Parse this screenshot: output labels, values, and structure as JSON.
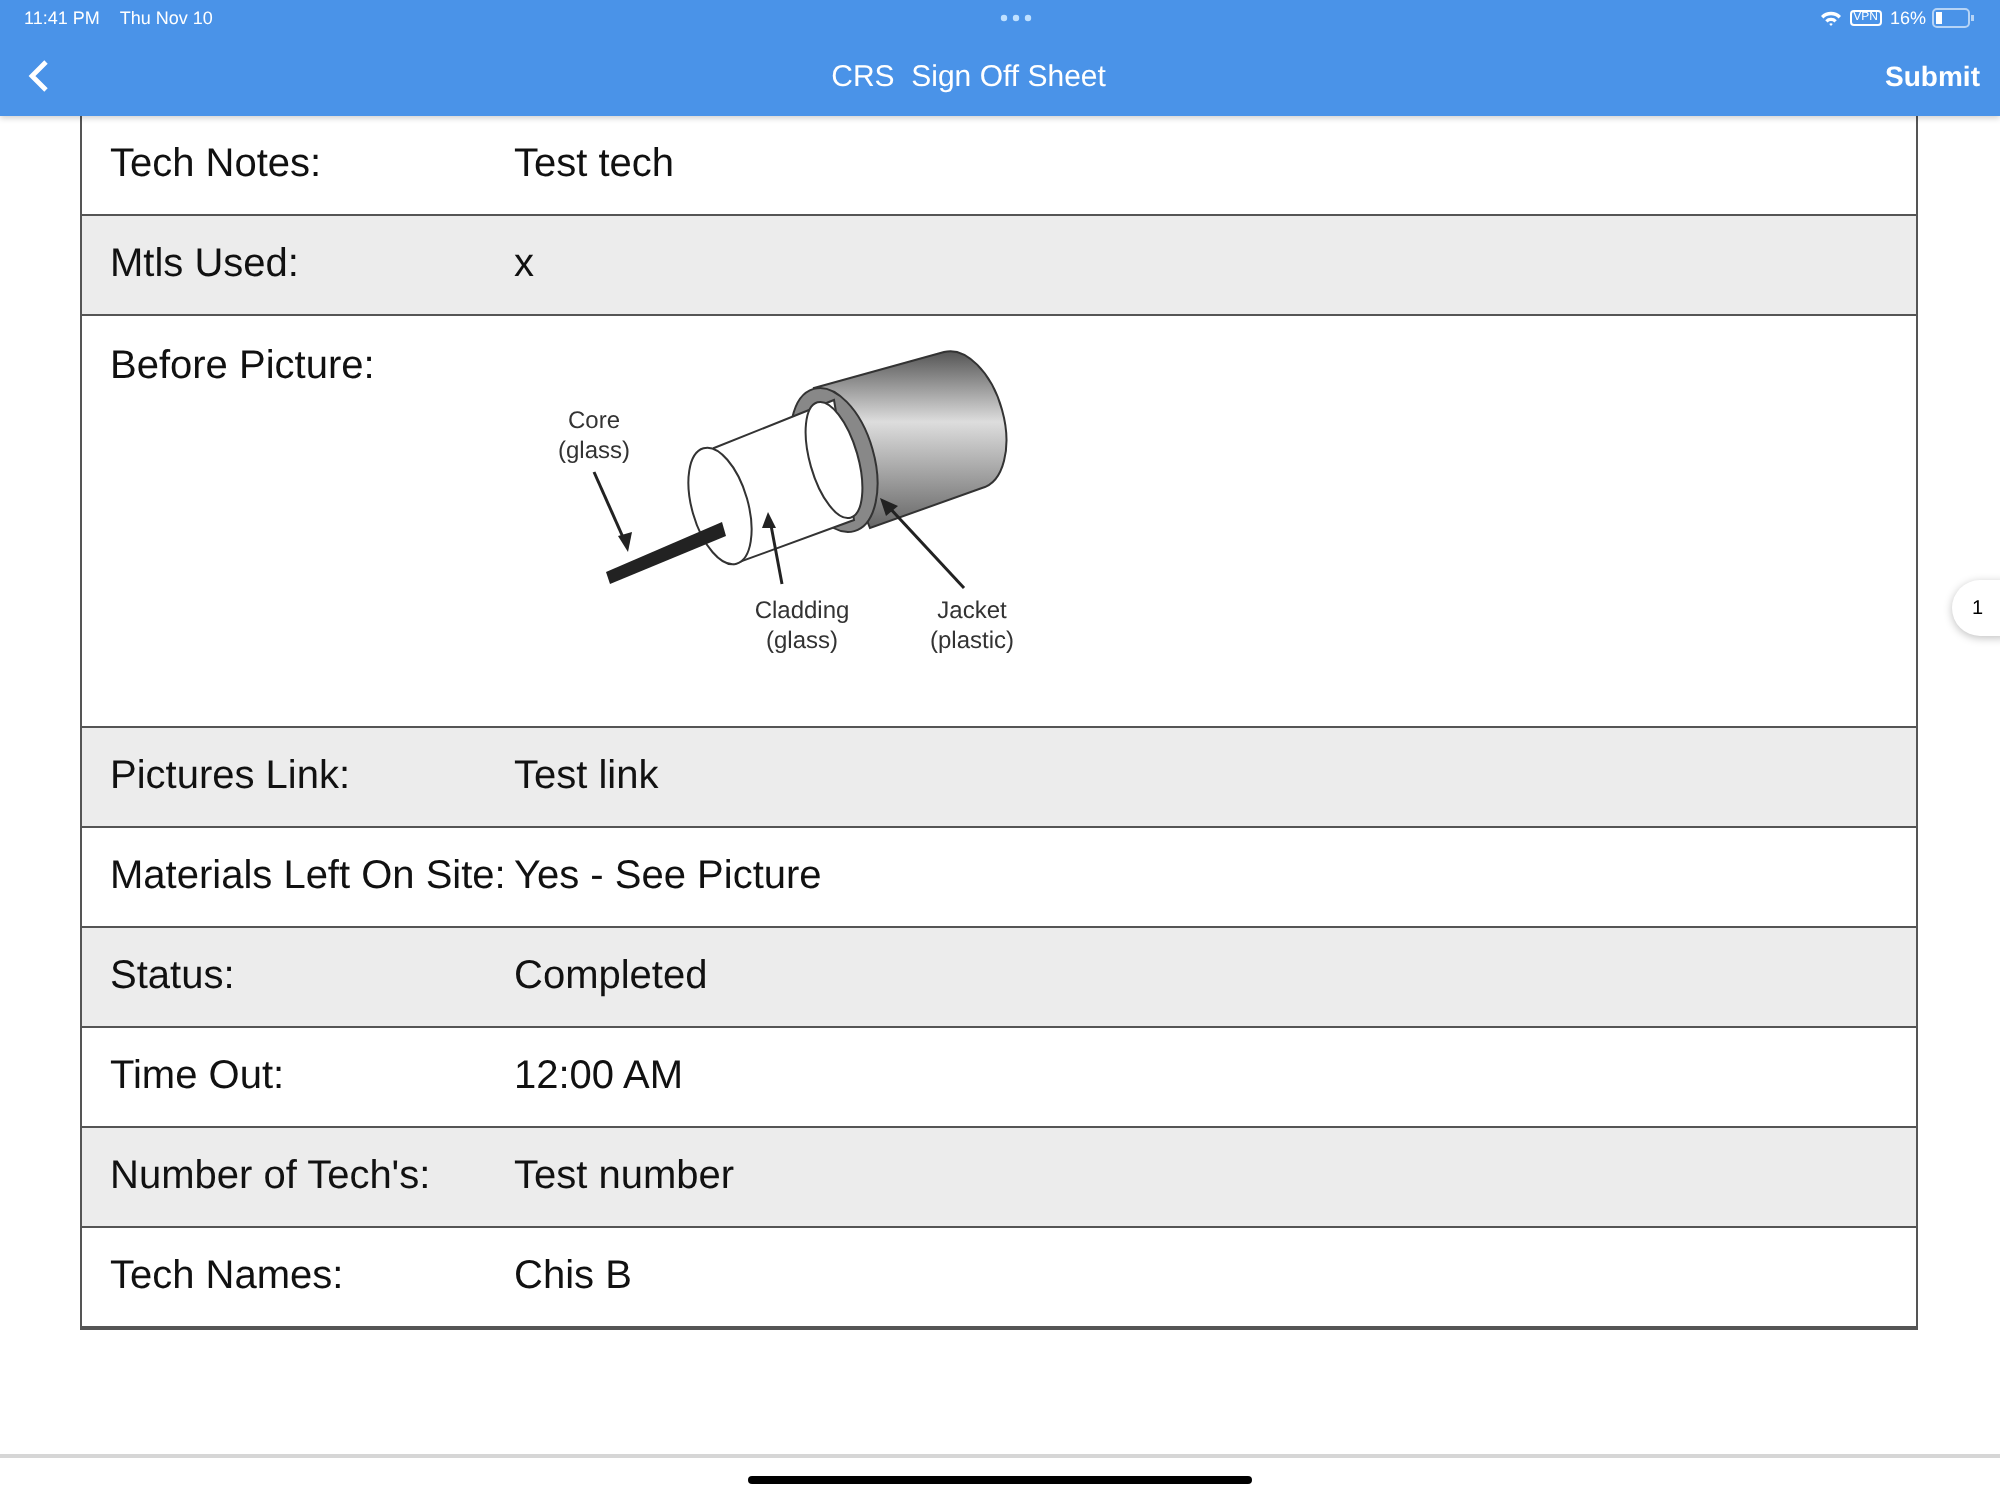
{
  "status_bar": {
    "time": "11:41 PM",
    "date": "Thu Nov 10",
    "vpn": "VPN",
    "battery": "16%"
  },
  "nav": {
    "title": "CRS  Sign Off Sheet",
    "action": "Submit"
  },
  "rows": [
    {
      "kind": "text",
      "label": "Tech Notes:",
      "value": "Test tech"
    },
    {
      "kind": "text",
      "label": "Mtls Used:",
      "value": "x"
    },
    {
      "kind": "picture",
      "label": "Before Picture:",
      "callouts": [
        "Core\n(glass)",
        "Cladding\n(glass)",
        "Jacket\n(plastic)"
      ]
    },
    {
      "kind": "text",
      "label": "Pictures Link:",
      "value": "Test link"
    },
    {
      "kind": "text",
      "label": "Materials Left On Site:",
      "value": "Yes - See Picture"
    },
    {
      "kind": "text",
      "label": "Status:",
      "value": "Completed"
    },
    {
      "kind": "text",
      "label": "Time Out:",
      "value": "12:00 AM"
    },
    {
      "kind": "text",
      "label": "Number of Tech's:",
      "value": "Test number"
    },
    {
      "kind": "text",
      "label": "Tech Names:",
      "value": "Chis B"
    }
  ],
  "page_badge": "1"
}
